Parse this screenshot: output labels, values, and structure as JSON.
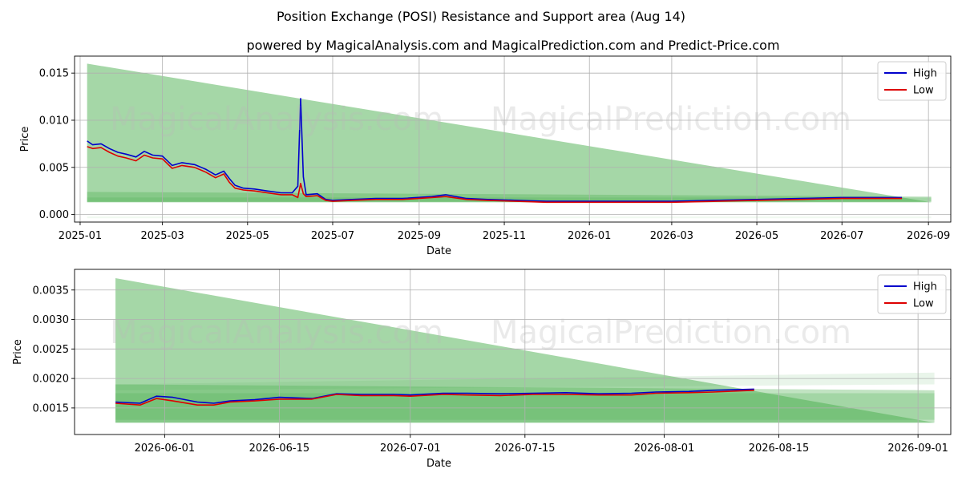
{
  "header": {
    "title": "Position Exchange (POSI) Resistance and Support area (Aug 14)",
    "subtitle": "powered by MagicalAnalysis.com and MagicalPrediction.com and Predict-Price.com"
  },
  "watermarks": [
    "MagicalAnalysis.com",
    "MagicalPrediction.com"
  ],
  "colors": {
    "high": "#0000cc",
    "low": "#dd0000",
    "band": "#4caf50",
    "grid": "#b0b0b0"
  },
  "chart_data": [
    {
      "type": "line",
      "name": "top",
      "xlabel": "Date",
      "ylabel": "Price",
      "xlim": [
        "2024-12-28",
        "2026-09-17"
      ],
      "ylim": [
        -0.0008,
        0.0168
      ],
      "xticks": [
        "2025-01-01",
        "2025-03-01",
        "2025-05-01",
        "2025-07-01",
        "2025-09-01",
        "2025-11-01",
        "2026-01-01",
        "2026-03-01",
        "2026-05-01",
        "2026-07-01",
        "2026-09-01"
      ],
      "xtick_labels": [
        "2025-01",
        "2025-03",
        "2025-05",
        "2025-07",
        "2025-09",
        "2025-11",
        "2026-01",
        "2026-03",
        "2026-05",
        "2026-07",
        "2026-09"
      ],
      "yticks": [
        0.0,
        0.005,
        0.01,
        0.015
      ],
      "ytick_labels": [
        "0.000",
        "0.005",
        "0.010",
        "0.015"
      ],
      "grid": true,
      "legend": "top-right",
      "bands": [
        {
          "start": "2025-01-06",
          "end": "2026-09-03",
          "upper_start": 0.016,
          "upper_end": 0.0013,
          "lower_start": 0.0013,
          "lower_end": 0.0013,
          "opacity": 0.5
        },
        {
          "start": "2025-01-06",
          "end": "2026-09-03",
          "upper_start": 0.0024,
          "upper_end": 0.0019,
          "lower_start": 0.0013,
          "lower_end": 0.0013,
          "opacity": 0.35
        },
        {
          "start": "2025-01-06",
          "end": "2026-09-03",
          "upper_start": 0.0018,
          "upper_end": 0.0018,
          "lower_start": 0.0014,
          "lower_end": 0.0014,
          "opacity": 0.25
        },
        {
          "start": "2025-01-06",
          "end": "2026-09-03",
          "upper_start": -0.0002,
          "upper_end": -0.0002,
          "lower_start": -0.0004,
          "lower_end": -0.0004,
          "opacity": 0.08
        }
      ],
      "series": [
        {
          "name": "High",
          "color": "#0000cc",
          "x": [
            "2025-01-06",
            "2025-01-10",
            "2025-01-16",
            "2025-01-22",
            "2025-01-28",
            "2025-02-03",
            "2025-02-10",
            "2025-02-16",
            "2025-02-22",
            "2025-03-01",
            "2025-03-08",
            "2025-03-15",
            "2025-03-24",
            "2025-04-01",
            "2025-04-08",
            "2025-04-14",
            "2025-04-18",
            "2025-04-22",
            "2025-04-28",
            "2025-05-06",
            "2025-05-15",
            "2025-05-25",
            "2025-06-02",
            "2025-06-06",
            "2025-06-08",
            "2025-06-10",
            "2025-06-12",
            "2025-06-20",
            "2025-06-26",
            "2025-07-01",
            "2025-07-15",
            "2025-08-01",
            "2025-08-20",
            "2025-09-10",
            "2025-09-20",
            "2025-10-05",
            "2025-10-20",
            "2025-11-10",
            "2025-12-01",
            "2026-01-01",
            "2026-02-01",
            "2026-03-01",
            "2026-04-01",
            "2026-05-01",
            "2026-06-01",
            "2026-07-01",
            "2026-07-20",
            "2026-08-13"
          ],
          "y": [
            0.0078,
            0.0074,
            0.0075,
            0.007,
            0.0066,
            0.0064,
            0.0061,
            0.0067,
            0.0063,
            0.0062,
            0.0052,
            0.0055,
            0.0053,
            0.0048,
            0.0042,
            0.0046,
            0.0038,
            0.0031,
            0.0028,
            0.0027,
            0.0025,
            0.0023,
            0.0023,
            0.003,
            0.0123,
            0.004,
            0.0021,
            0.0022,
            0.0016,
            0.0015,
            0.0016,
            0.0017,
            0.0017,
            0.0019,
            0.0021,
            0.0017,
            0.0016,
            0.0015,
            0.0014,
            0.0014,
            0.0014,
            0.0014,
            0.0015,
            0.0016,
            0.0017,
            0.0018,
            0.0018,
            0.0018
          ]
        },
        {
          "name": "Low",
          "color": "#dd0000",
          "x": [
            "2025-01-06",
            "2025-01-10",
            "2025-01-16",
            "2025-01-22",
            "2025-01-28",
            "2025-02-03",
            "2025-02-10",
            "2025-02-16",
            "2025-02-22",
            "2025-03-01",
            "2025-03-08",
            "2025-03-15",
            "2025-03-24",
            "2025-04-01",
            "2025-04-08",
            "2025-04-14",
            "2025-04-18",
            "2025-04-22",
            "2025-04-28",
            "2025-05-06",
            "2025-05-15",
            "2025-05-25",
            "2025-06-02",
            "2025-06-06",
            "2025-06-08",
            "2025-06-10",
            "2025-06-12",
            "2025-06-20",
            "2025-06-26",
            "2025-07-01",
            "2025-07-15",
            "2025-08-01",
            "2025-08-20",
            "2025-09-10",
            "2025-09-20",
            "2025-10-05",
            "2025-10-20",
            "2025-11-10",
            "2025-12-01",
            "2026-01-01",
            "2026-02-01",
            "2026-03-01",
            "2026-04-01",
            "2026-05-01",
            "2026-06-01",
            "2026-07-01",
            "2026-07-20",
            "2026-08-13"
          ],
          "y": [
            0.0072,
            0.007,
            0.0071,
            0.0066,
            0.0062,
            0.006,
            0.0057,
            0.0063,
            0.006,
            0.0059,
            0.0049,
            0.0052,
            0.005,
            0.0045,
            0.0039,
            0.0043,
            0.0034,
            0.0028,
            0.0026,
            0.0025,
            0.0023,
            0.0021,
            0.0021,
            0.0018,
            0.0033,
            0.0022,
            0.0019,
            0.002,
            0.0015,
            0.0014,
            0.0015,
            0.0016,
            0.0016,
            0.0018,
            0.0019,
            0.0016,
            0.0015,
            0.0014,
            0.0013,
            0.0013,
            0.0013,
            0.0013,
            0.0014,
            0.0015,
            0.0016,
            0.0017,
            0.0017,
            0.0017
          ]
        }
      ]
    },
    {
      "type": "line",
      "name": "bottom",
      "xlabel": "Date",
      "ylabel": "Price",
      "xlim": [
        "2026-05-21",
        "2026-09-05"
      ],
      "ylim": [
        0.00105,
        0.00385
      ],
      "xticks": [
        "2026-06-01",
        "2026-06-15",
        "2026-07-01",
        "2026-07-15",
        "2026-08-01",
        "2026-08-15",
        "2026-09-01"
      ],
      "xtick_labels": [
        "2026-06-01",
        "2026-06-15",
        "2026-07-01",
        "2026-07-15",
        "2026-08-01",
        "2026-08-15",
        "2026-09-01"
      ],
      "yticks": [
        0.0015,
        0.002,
        0.0025,
        0.003,
        0.0035
      ],
      "ytick_labels": [
        "0.0015",
        "0.0020",
        "0.0025",
        "0.0030",
        "0.0035"
      ],
      "grid": true,
      "legend": "top-right",
      "bands": [
        {
          "start": "2026-05-26",
          "end": "2026-09-03",
          "upper_start": 0.0037,
          "upper_end": 0.00125,
          "lower_start": 0.00125,
          "lower_end": 0.00125,
          "opacity": 0.5
        },
        {
          "start": "2026-05-26",
          "end": "2026-09-03",
          "upper_start": 0.0019,
          "upper_end": 0.0018,
          "lower_start": 0.00125,
          "lower_end": 0.00125,
          "opacity": 0.35
        },
        {
          "start": "2026-05-26",
          "end": "2026-09-03",
          "upper_start": 0.00175,
          "upper_end": 0.00175,
          "lower_start": 0.0013,
          "lower_end": 0.0013,
          "opacity": 0.25
        },
        {
          "start": "2026-05-26",
          "end": "2026-09-03",
          "upper_start": 0.0019,
          "upper_end": 0.0021,
          "lower_start": 0.0018,
          "lower_end": 0.0019,
          "opacity": 0.12
        }
      ],
      "series": [
        {
          "name": "High",
          "color": "#0000cc",
          "x": [
            "2026-05-26",
            "2026-05-29",
            "2026-05-31",
            "2026-06-02",
            "2026-06-05",
            "2026-06-07",
            "2026-06-09",
            "2026-06-12",
            "2026-06-15",
            "2026-06-19",
            "2026-06-22",
            "2026-06-25",
            "2026-06-29",
            "2026-07-01",
            "2026-07-05",
            "2026-07-08",
            "2026-07-12",
            "2026-07-16",
            "2026-07-20",
            "2026-07-24",
            "2026-07-28",
            "2026-07-31",
            "2026-08-04",
            "2026-08-07",
            "2026-08-12"
          ],
          "y": [
            0.0016,
            0.00158,
            0.0017,
            0.00168,
            0.0016,
            0.00158,
            0.00162,
            0.00164,
            0.00168,
            0.00166,
            0.00174,
            0.00173,
            0.00173,
            0.00172,
            0.00175,
            0.00175,
            0.00174,
            0.00175,
            0.00176,
            0.00174,
            0.00175,
            0.00177,
            0.00178,
            0.0018,
            0.00182
          ]
        },
        {
          "name": "Low",
          "color": "#dd0000",
          "x": [
            "2026-05-26",
            "2026-05-29",
            "2026-05-31",
            "2026-06-02",
            "2026-06-05",
            "2026-06-07",
            "2026-06-09",
            "2026-06-12",
            "2026-06-15",
            "2026-06-19",
            "2026-06-22",
            "2026-06-25",
            "2026-06-29",
            "2026-07-01",
            "2026-07-05",
            "2026-07-08",
            "2026-07-12",
            "2026-07-16",
            "2026-07-20",
            "2026-07-24",
            "2026-07-28",
            "2026-07-31",
            "2026-08-04",
            "2026-08-07",
            "2026-08-12"
          ],
          "y": [
            0.00158,
            0.00155,
            0.00166,
            0.00162,
            0.00155,
            0.00155,
            0.0016,
            0.00162,
            0.00165,
            0.00165,
            0.00173,
            0.00171,
            0.00171,
            0.0017,
            0.00173,
            0.00172,
            0.00171,
            0.00173,
            0.00173,
            0.00172,
            0.00172,
            0.00175,
            0.00176,
            0.00177,
            0.0018
          ]
        }
      ]
    }
  ]
}
